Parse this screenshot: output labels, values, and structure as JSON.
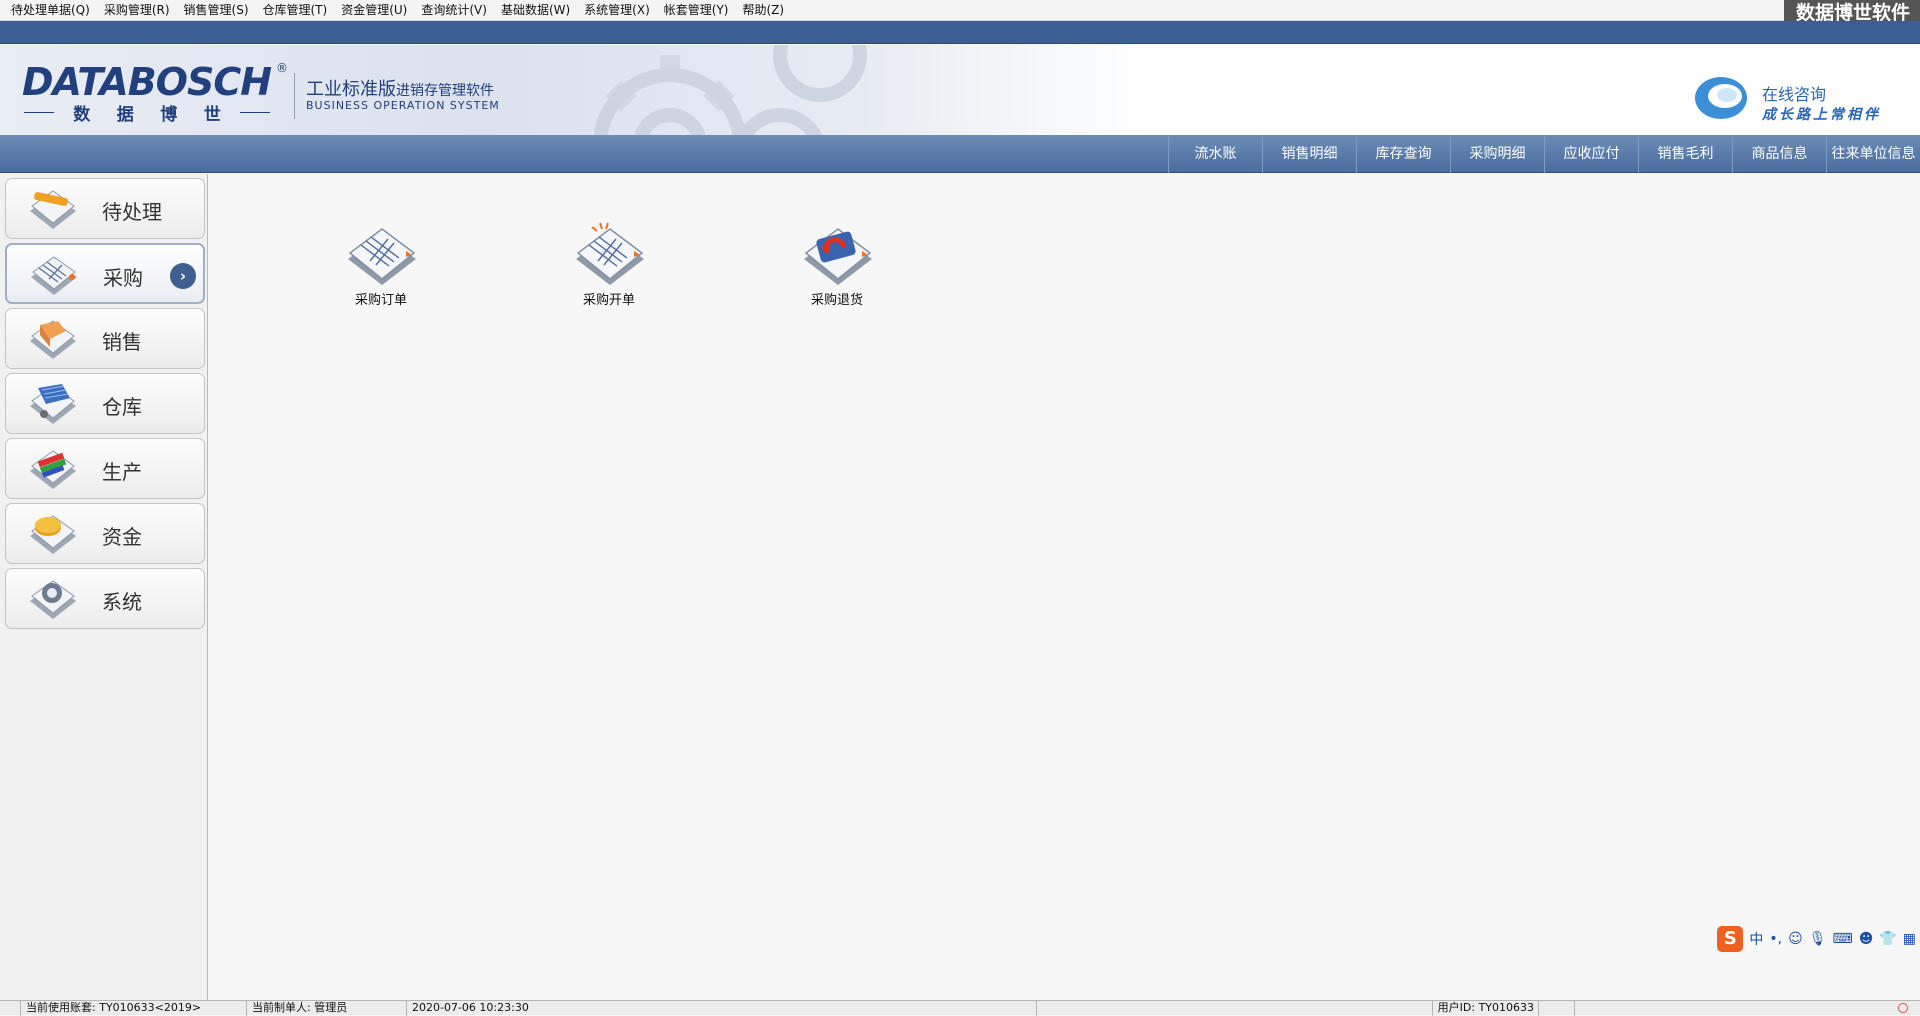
{
  "menubar": {
    "items": [
      "待处理单据(Q)",
      "采购管理(R)",
      "销售管理(S)",
      "仓库管理(T)",
      "资金管理(U)",
      "查询统计(V)",
      "基础数据(W)",
      "系统管理(X)",
      "帐套管理(Y)",
      "帮助(Z)"
    ],
    "watermark": "数据博世软件"
  },
  "banner": {
    "logo_word": "DATABOSCH",
    "logo_reg": "®",
    "logo_cn_chars": [
      "数",
      "据",
      "博",
      "世"
    ],
    "product_name": "工业标准版",
    "product_sub": "进销存管理软件",
    "product_en": "BUSINESS OPERATION SYSTEM",
    "consult_title": "在线咨询",
    "consult_sub": "成长路上常相伴"
  },
  "quicknav": {
    "items": [
      "流水账",
      "销售明细",
      "库存查询",
      "采购明细",
      "应收应付",
      "销售毛利",
      "商品信息",
      "往来单位信息"
    ]
  },
  "sidebar": {
    "items": [
      {
        "label": "待处理",
        "icon": "pending-icon"
      },
      {
        "label": "采购",
        "icon": "purchase-icon",
        "active": true
      },
      {
        "label": "销售",
        "icon": "sales-icon"
      },
      {
        "label": "仓库",
        "icon": "warehouse-icon"
      },
      {
        "label": "生产",
        "icon": "production-icon"
      },
      {
        "label": "资金",
        "icon": "funds-icon"
      },
      {
        "label": "系统",
        "icon": "system-icon"
      }
    ],
    "active_arrow": "›"
  },
  "workspace": {
    "items": [
      {
        "label": "采购订单",
        "icon": "purchase-order-icon"
      },
      {
        "label": "采购开单",
        "icon": "purchase-invoice-icon"
      },
      {
        "label": "采购退货",
        "icon": "purchase-return-icon"
      }
    ],
    "ime": {
      "logo": "S",
      "mode": "中",
      "punct": "•,"
    }
  },
  "statusbar": {
    "account_label": "当前使用账套:",
    "account_value": "TY010633<2019>",
    "operator_label": "当前制单人:",
    "operator_value": "管理员",
    "datetime": "2020-07-06 10:23:30",
    "user_id_label": "用户ID:",
    "user_id_value": "TY010633"
  },
  "colors": {
    "brand_blue": "#22407d",
    "nav_blue": "#4a6c9e",
    "strip_blue": "#3b5f92",
    "accent_orange": "#f06020"
  }
}
